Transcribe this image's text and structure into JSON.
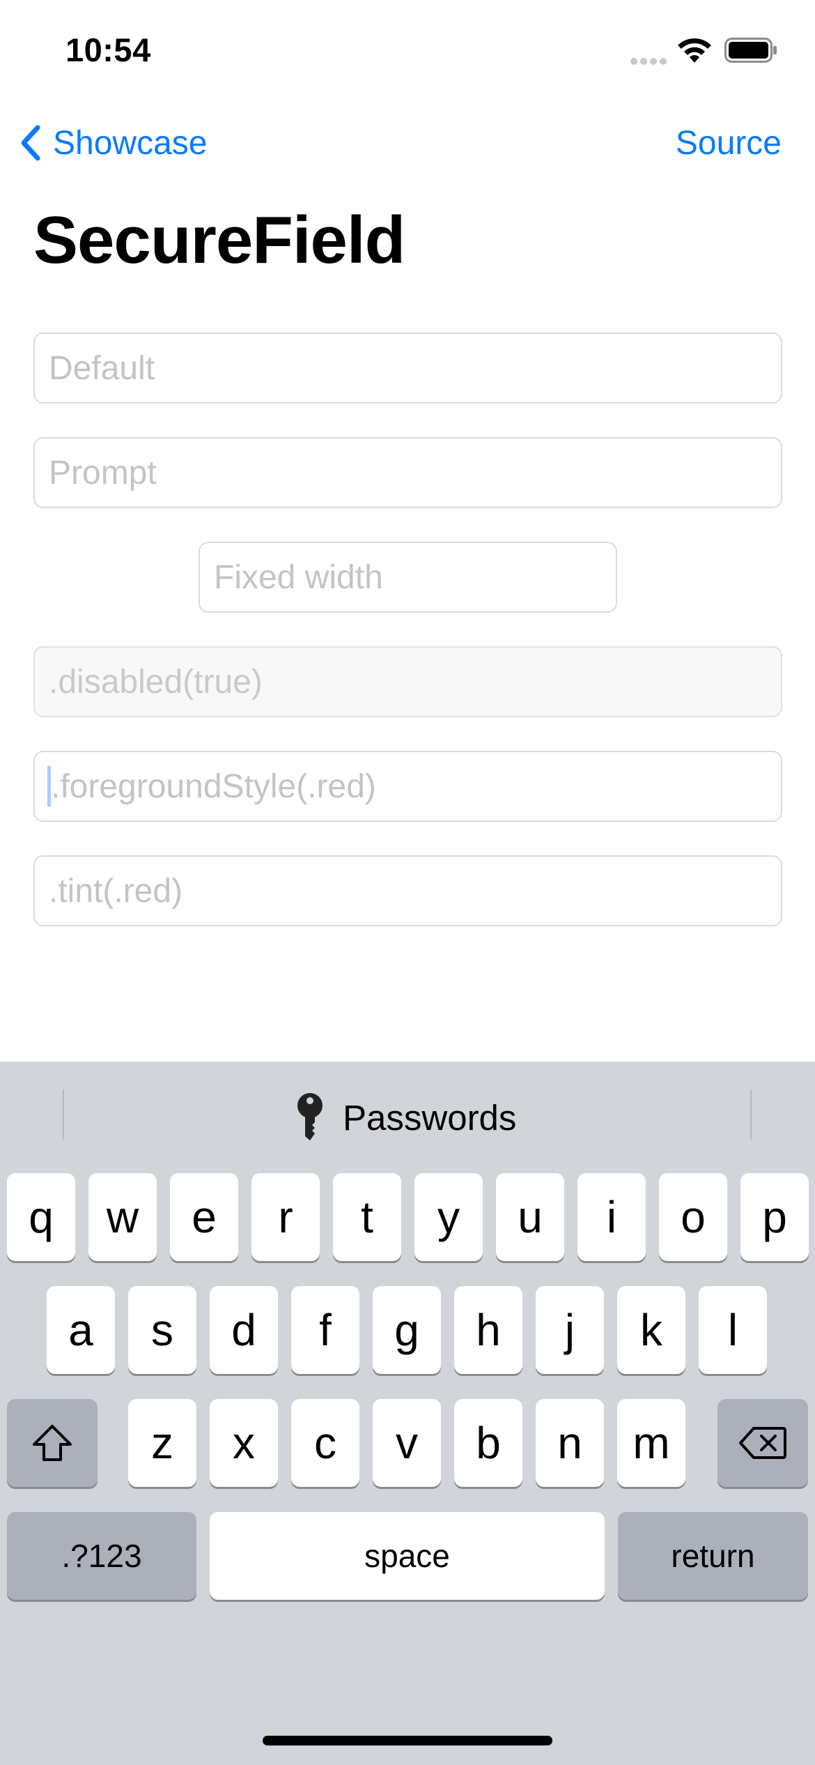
{
  "status_bar": {
    "time": "10:54"
  },
  "nav": {
    "back_label": "Showcase",
    "source_label": "Source"
  },
  "page": {
    "title": "SecureField"
  },
  "fields": [
    {
      "placeholder": "Default",
      "state": "normal"
    },
    {
      "placeholder": "Prompt",
      "state": "normal"
    },
    {
      "placeholder": "Fixed width",
      "state": "normal"
    },
    {
      "placeholder": ".disabled(true)",
      "state": "disabled"
    },
    {
      "placeholder": ".foregroundStyle(.red)",
      "state": "focused"
    },
    {
      "placeholder": ".tint(.red)",
      "state": "normal"
    }
  ],
  "keyboard": {
    "suggestion": {
      "label": "Passwords",
      "icon": "key-icon"
    },
    "row1": [
      "q",
      "w",
      "e",
      "r",
      "t",
      "y",
      "u",
      "i",
      "o",
      "p"
    ],
    "row2": [
      "a",
      "s",
      "d",
      "f",
      "g",
      "h",
      "j",
      "k",
      "l"
    ],
    "row3": [
      "z",
      "x",
      "c",
      "v",
      "b",
      "n",
      "m"
    ],
    "numbers_label": ".?123",
    "space_label": "space",
    "return_label": "return"
  },
  "colors": {
    "accent": "#0a7aff",
    "keyboard_bg": "#d1d4d9",
    "special_key": "#abb0ba"
  }
}
